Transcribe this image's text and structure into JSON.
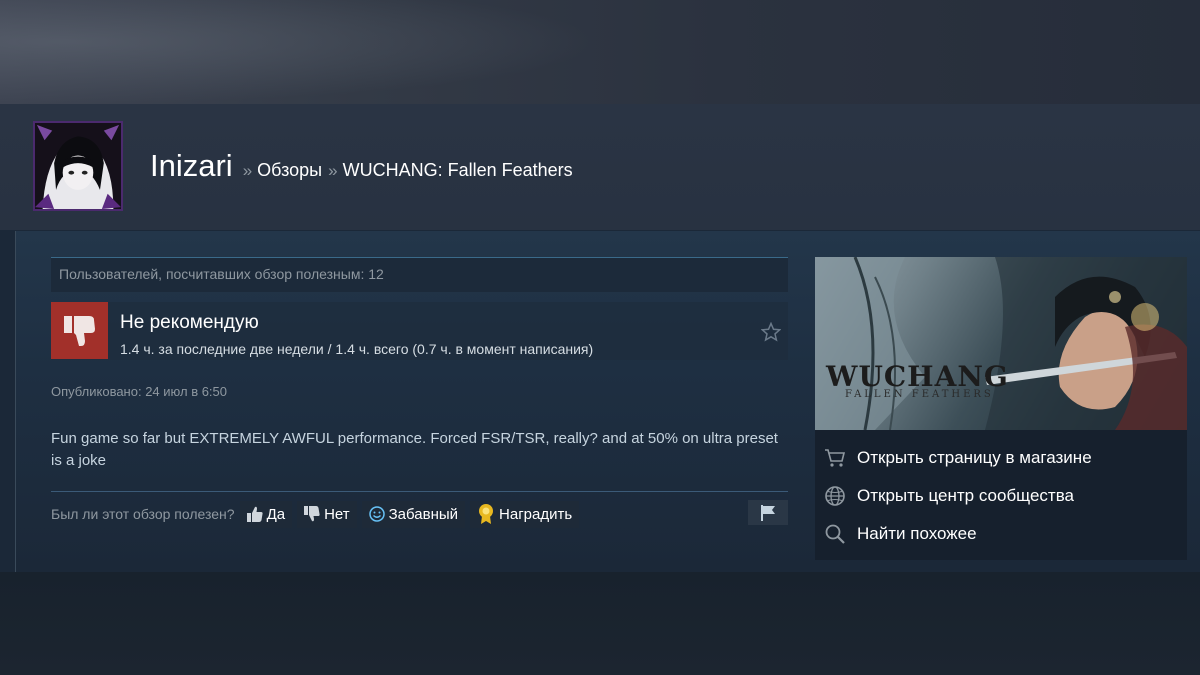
{
  "header": {
    "username": "Inizari",
    "sep": "»",
    "crumb_reviews": "Обзоры",
    "crumb_game": "WUCHANG: Fallen Feathers"
  },
  "review": {
    "helpful_count_text": "Пользователей, посчитавших обзор полезным: 12",
    "verdict": "Не рекомендую",
    "hours": "1.4 ч. за последние две недели / 1.4 ч. всего (0.7 ч. в момент написания)",
    "posted": "Опубликовано: 24 июл в 6:50",
    "text": "Fun game so far but EXTREMELY AWFUL performance. Forced FSR/TSR, really? and at 50% on ultra preset is a joke"
  },
  "vote": {
    "question": "Был ли этот обзор полезен?",
    "yes": "Да",
    "no": "Нет",
    "funny": "Забавный",
    "award": "Наградить"
  },
  "side": {
    "game_logo": "WUCHANG",
    "game_subtitle": "FALLEN FEATHERS",
    "links": [
      {
        "label": "Открыть страницу в магазине",
        "icon": "cart-icon"
      },
      {
        "label": "Открыть центр сообщества",
        "icon": "globe-icon"
      },
      {
        "label": "Найти похожее",
        "icon": "search-icon"
      }
    ]
  },
  "colors": {
    "background": "#1b2838",
    "not_recommended": "#a2302a",
    "link": "#ffffff",
    "muted": "#8f98a0"
  }
}
